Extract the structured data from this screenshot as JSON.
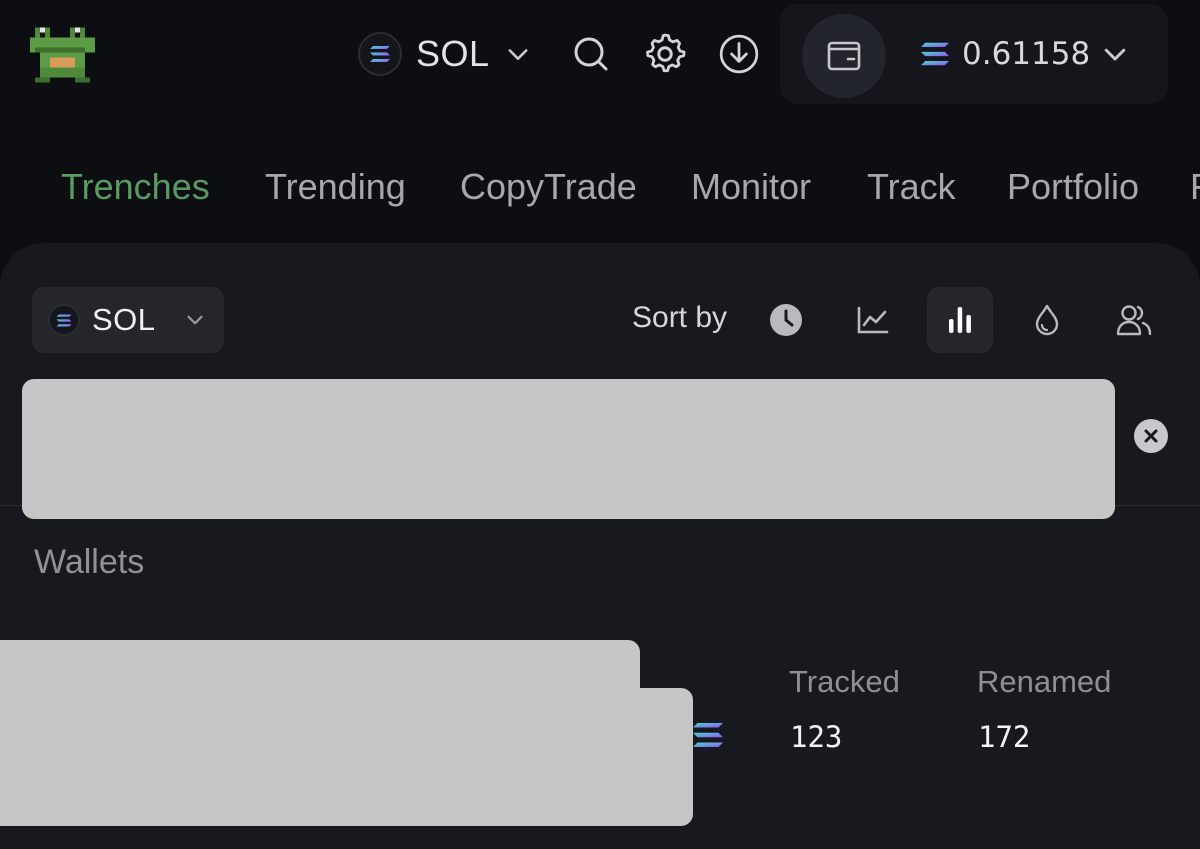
{
  "header": {
    "logo": "frog-logo",
    "chain": {
      "label": "SOL",
      "icon": "solana-icon"
    },
    "icons": [
      "search-icon",
      "gear-icon",
      "download-icon"
    ],
    "wallet": {
      "icon": "wallet-icon",
      "balance": "0.61158"
    }
  },
  "nav": {
    "items": [
      {
        "label": "Trenches",
        "active": true
      },
      {
        "label": "Trending",
        "active": false
      },
      {
        "label": "CopyTrade",
        "active": false
      },
      {
        "label": "Monitor",
        "active": false
      },
      {
        "label": "Track",
        "active": false
      },
      {
        "label": "Portfolio",
        "active": false
      }
    ]
  },
  "filters": {
    "chain_label": "SOL",
    "sort_label": "Sort by",
    "sort_icons": [
      "clock-icon",
      "line-chart-icon",
      "bar-chart-icon",
      "liquidity-drop-icon",
      "users-icon"
    ],
    "active_sort": "bar-chart-icon"
  },
  "search": {
    "value": ""
  },
  "wallets": {
    "title": "Wallets",
    "stats": [
      {
        "label": "Tracked",
        "value": "123"
      },
      {
        "label": "Renamed",
        "value": "172"
      }
    ]
  },
  "colors": {
    "background": "#0d0e12",
    "panel": "#18191e",
    "active_nav": "#5a9a63",
    "redaction": "#c6c6c6"
  }
}
